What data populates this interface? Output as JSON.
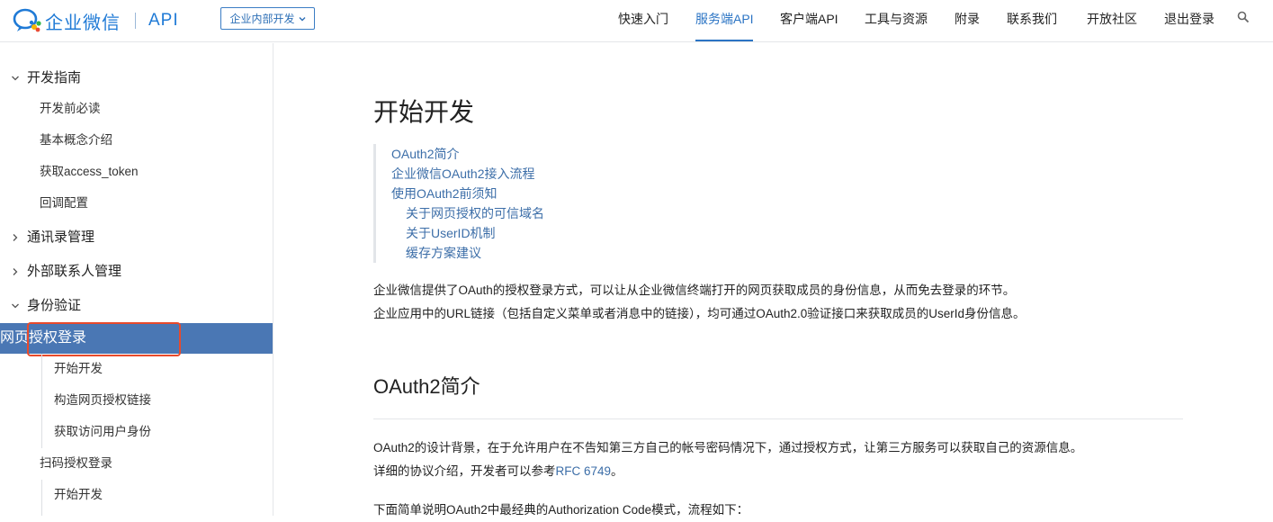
{
  "header": {
    "logo_text": "企业微信",
    "logo_api": "API",
    "context_selector": "企业内部开发",
    "nav": [
      "快速入门",
      "服务端API",
      "客户端API",
      "工具与资源",
      "附录",
      "联系我们",
      "开放社区",
      "退出登录"
    ],
    "active_nav": "服务端API"
  },
  "sidebar": {
    "groups": [
      {
        "label": "开发指南",
        "expanded": true
      },
      {
        "label": "通讯录管理",
        "expanded": false
      },
      {
        "label": "外部联系人管理",
        "expanded": false
      },
      {
        "label": "身份验证",
        "expanded": true
      }
    ],
    "dev_items": [
      "开发前必读",
      "基本概念介绍",
      "获取access_token",
      "回调配置"
    ],
    "auth_items": {
      "active": "网页授权登录",
      "active_children": [
        "开始开发",
        "构造网页授权链接",
        "获取访问用户身份"
      ],
      "next": "扫码授权登录",
      "next_children": [
        "开始开发"
      ]
    }
  },
  "main": {
    "title": "开始开发",
    "toc": [
      {
        "label": "OAuth2简介",
        "level": 1
      },
      {
        "label": "企业微信OAuth2接入流程",
        "level": 1
      },
      {
        "label": "使用OAuth2前须知",
        "level": 1
      },
      {
        "label": "关于网页授权的可信域名",
        "level": 2
      },
      {
        "label": "关于UserID机制",
        "level": 2
      },
      {
        "label": "缓存方案建议",
        "level": 2
      }
    ],
    "intro": [
      "企业微信提供了OAuth的授权登录方式，可以让从企业微信终端打开的网页获取成员的身份信息，从而免去登录的环节。",
      "企业应用中的URL链接（包括自定义菜单或者消息中的链接），均可通过OAuth2.0验证接口来获取成员的UserId身份信息。"
    ],
    "section_title": "OAuth2简介",
    "section_p1": "OAuth2的设计背景，在于允许用户在不告知第三方自己的帐号密码情况下，通过授权方式，让第三方服务可以获取自己的资源信息。",
    "section_p2_prefix": "详细的协议介绍，开发者可以参考",
    "section_p2_link": "RFC 6749",
    "section_p2_suffix": "。",
    "section_p3": "下面简单说明OAuth2中最经典的Authorization Code模式，流程如下："
  },
  "colors": {
    "brand": "#1f7ad6",
    "active_nav": "#2b74c4",
    "sidebar_active_bg": "#4a77b4",
    "link": "#3c6ea8",
    "highlight": "#e84a2c"
  }
}
